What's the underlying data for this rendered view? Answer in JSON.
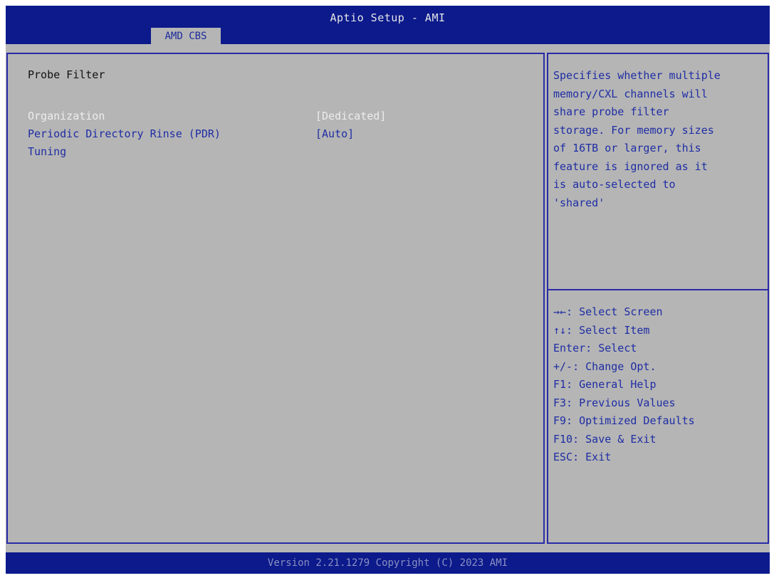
{
  "header": {
    "title": "Aptio Setup - AMI",
    "active_tab": "AMD CBS"
  },
  "main": {
    "section_title": "Probe Filter",
    "items": [
      {
        "label": "Organization",
        "value": "[Dedicated]",
        "selected": true
      },
      {
        "label": "Periodic Directory Rinse (PDR)",
        "value": "[Auto]",
        "selected": false
      },
      {
        "label": "Tuning",
        "value": "",
        "selected": false
      }
    ]
  },
  "help": {
    "lines": [
      "Specifies whether multiple",
      "memory/CXL channels will",
      "share probe filter",
      "storage. For memory sizes",
      "of 16TB or larger, this",
      "feature is ignored as it",
      "is auto-selected to",
      "'shared'"
    ]
  },
  "keys": [
    "→←: Select Screen",
    "↑↓: Select Item",
    "Enter: Select",
    "+/-: Change Opt.",
    "F1: General Help",
    "F3: Previous Values",
    "F9: Optimized Defaults",
    "F10: Save & Exit",
    "ESC: Exit"
  ],
  "footer": {
    "version": "Version 2.21.1279 Copyright (C) 2023 AMI"
  },
  "colors": {
    "title_bar": "#0c1a8c",
    "background": "#b5b5b5",
    "text_blue": "#1e2da4",
    "selected_text": "#ededed",
    "frame_border": "#2a2aa8"
  }
}
